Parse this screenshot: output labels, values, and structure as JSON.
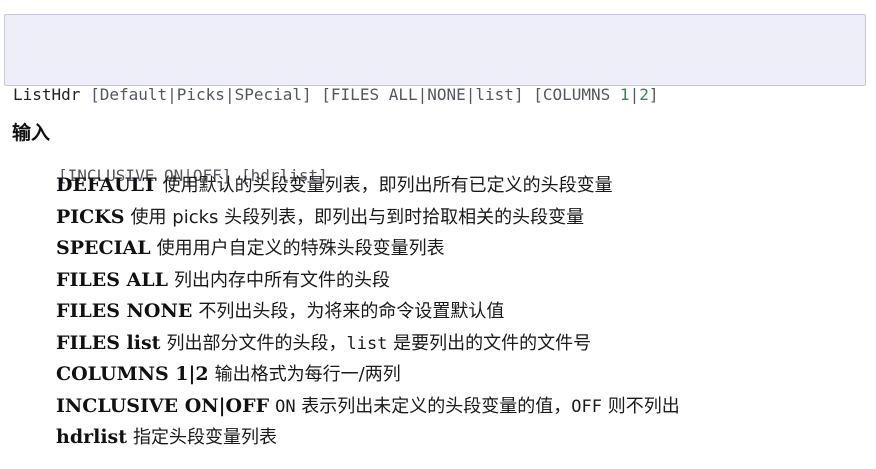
{
  "syntax": {
    "line1": {
      "command": "ListHdr",
      "group1": "[Default|Picks|SPecial]",
      "group2": "[FILES ALL|NONE|list]",
      "group3_prefix": "[COLUMNS ",
      "group3_num1": "1",
      "group3_sep": "|",
      "group3_num2": "2",
      "group3_suffix": "]"
    },
    "line2": {
      "group4": "[INCLUSIVE ON|OFF]",
      "group5": "[hdrlist]"
    }
  },
  "section": {
    "title": "输入"
  },
  "params": [
    {
      "key": "DEFAULT",
      "desc": "使用默认的头段变量列表，即列出所有已定义的头段变量"
    },
    {
      "key": "PICKS",
      "desc": "使用 picks 头段列表，即列出与到时拾取相关的头段变量"
    },
    {
      "key": "SPECIAL",
      "desc": "使用用户自定义的特殊头段变量列表"
    },
    {
      "key": "FILES ALL",
      "desc": "列出内存中所有文件的头段"
    },
    {
      "key": "FILES NONE",
      "desc": "不列出头段，为将来的命令设置默认值"
    },
    {
      "key": "FILES list",
      "desc_pre": "列出部分文件的头段，",
      "desc_code": "list",
      "desc_post": " 是要列出的文件的文件号"
    },
    {
      "key": "COLUMNS 1|2",
      "desc": "输出格式为每行一/两列"
    },
    {
      "key": "INCLUSIVE ON|OFF",
      "desc_code1": "ON",
      "desc_mid": " 表示列出未定义的头段变量的值，",
      "desc_code2": "OFF",
      "desc_post": " 则不列出"
    },
    {
      "key": "hdrlist",
      "desc": "指定头段变量列表"
    }
  ]
}
